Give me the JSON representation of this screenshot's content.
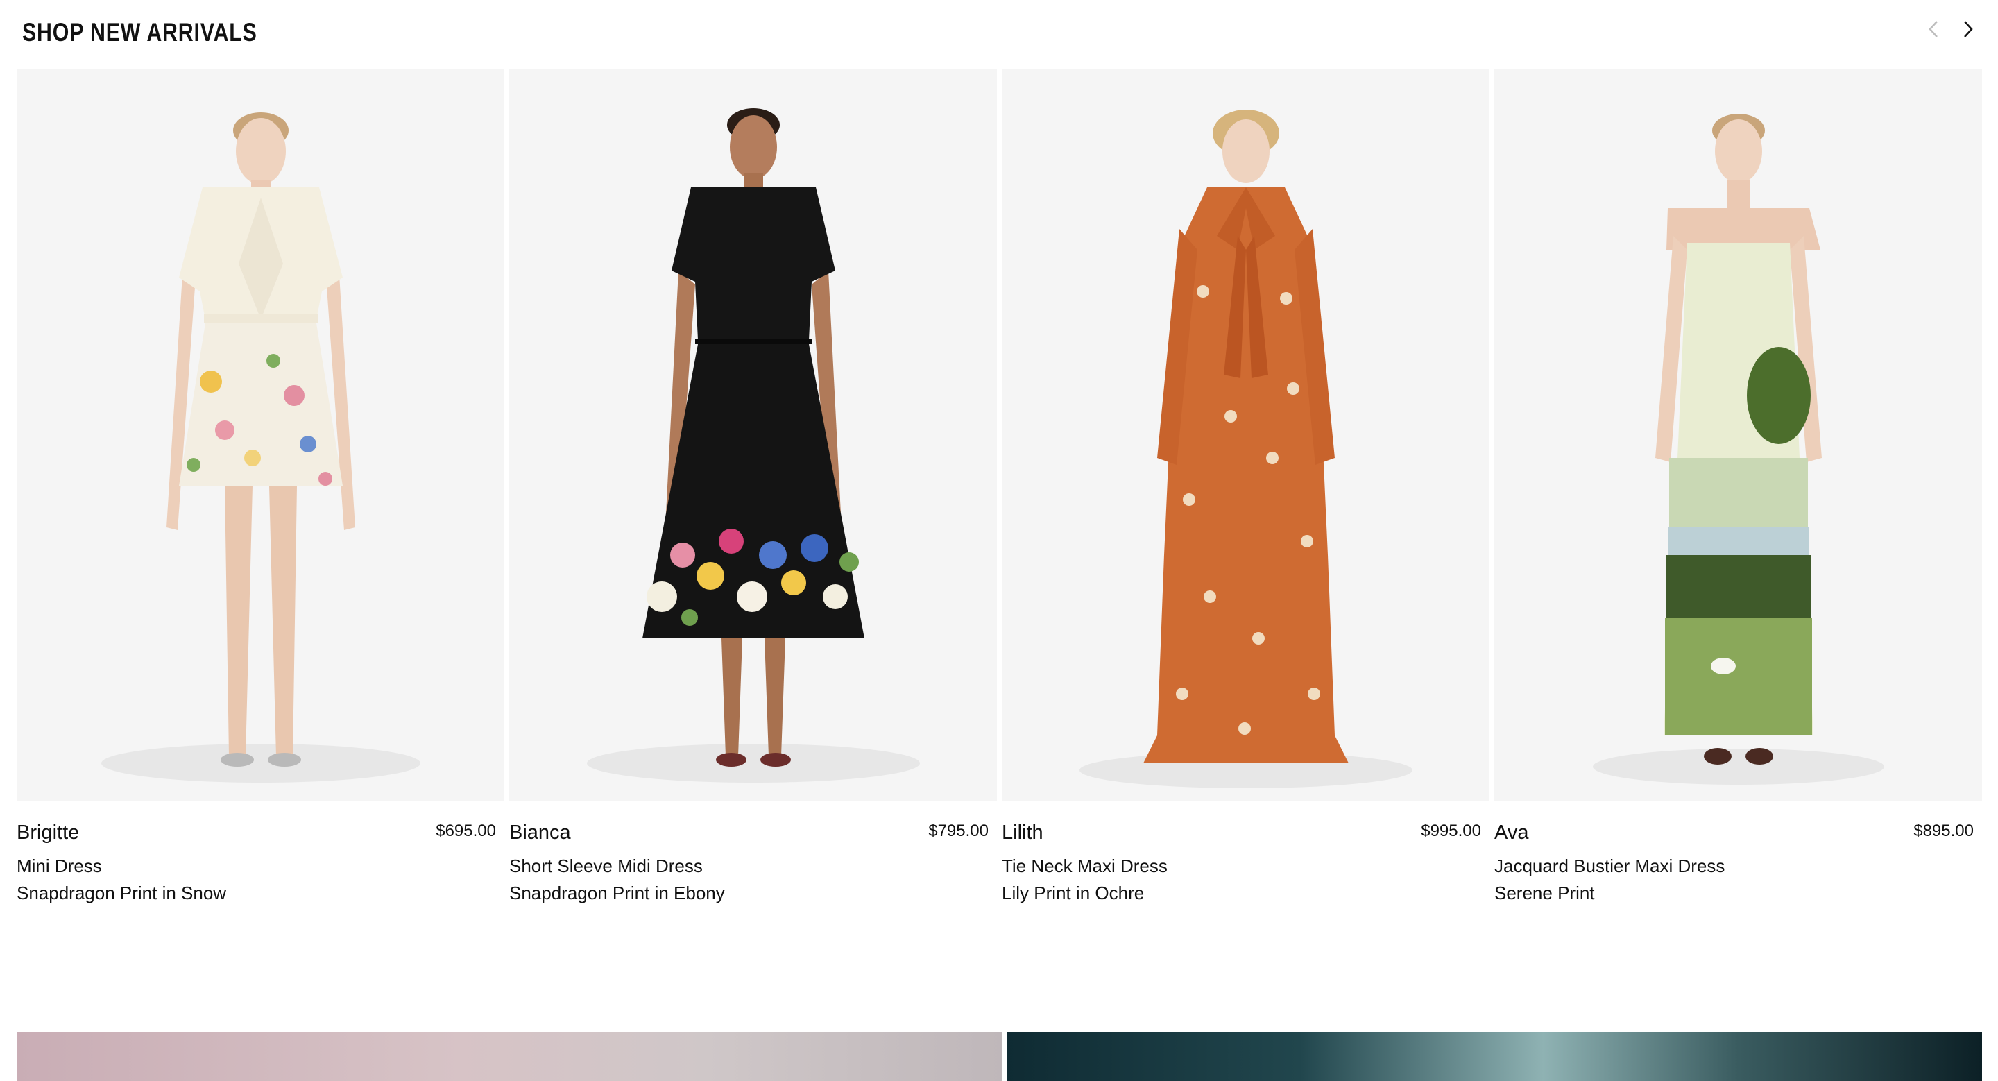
{
  "section": {
    "title": "SHOP NEW ARRIVALS"
  },
  "nav": {
    "prev_icon": "chevron-left-icon",
    "next_icon": "chevron-right-icon"
  },
  "products": [
    {
      "name": "Brigitte",
      "price": "$695.00",
      "style": "Mini Dress",
      "variant": "Snapdragon Print in Snow"
    },
    {
      "name": "Bianca",
      "price": "$795.00",
      "style": "Short Sleeve Midi Dress",
      "variant": "Snapdragon Print in Ebony"
    },
    {
      "name": "Lilith",
      "price": "$995.00",
      "style": "Tie Neck Maxi Dress",
      "variant": "Lily Print in Ochre"
    },
    {
      "name": "Ava",
      "price": "$895.00",
      "style": "Jacquard Bustier Maxi Dress",
      "variant": "Serene Print"
    }
  ]
}
